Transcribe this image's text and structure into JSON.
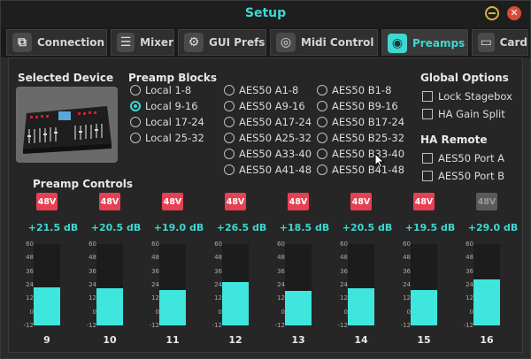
{
  "window": {
    "title": "Setup"
  },
  "tabs": [
    {
      "label": "Connection",
      "icon": "connection-icon",
      "active": false
    },
    {
      "label": "Mixer",
      "icon": "mixer-faders-icon",
      "active": false
    },
    {
      "label": "GUI Prefs",
      "icon": "gears-icon",
      "active": false
    },
    {
      "label": "Midi Control",
      "icon": "midi-port-icon",
      "active": false
    },
    {
      "label": "Preamps",
      "icon": "preamp-icon",
      "active": true
    },
    {
      "label": "Card",
      "icon": "card-icon",
      "active": false
    }
  ],
  "sections": {
    "selected_device": "Selected Device",
    "preamp_blocks": "Preamp Blocks",
    "global_options": "Global Options",
    "ha_remote": "HA Remote",
    "preamp_controls": "Preamp Controls"
  },
  "preamp_blocks": {
    "col1": [
      "Local 1-8",
      "Local 9-16",
      "Local 17-24",
      "Local 25-32"
    ],
    "col2": [
      "AES50 A1-8",
      "AES50 A9-16",
      "AES50 A17-24",
      "AES50 A25-32",
      "AES50 A33-40",
      "AES50 A41-48"
    ],
    "col3": [
      "AES50 B1-8",
      "AES50 B9-16",
      "AES50 B17-24",
      "AES50 B25-32",
      "AES50 B33-40",
      "AES50 B41-48"
    ],
    "selected": "Local 9-16"
  },
  "global_options": [
    {
      "label": "Lock Stagebox",
      "checked": false
    },
    {
      "label": "HA Gain Split",
      "checked": false
    }
  ],
  "ha_remote": [
    {
      "label": "AES50 Port A",
      "checked": false
    },
    {
      "label": "AES50 Port B",
      "checked": false
    }
  ],
  "meter_scale": [
    "60",
    "48",
    "36",
    "24",
    "12",
    "0",
    "-12"
  ],
  "channels": [
    {
      "num": "9",
      "phantom_label": "48V",
      "phantom_on": true,
      "gain": "+21.5 dB",
      "gain_db": 21.5
    },
    {
      "num": "10",
      "phantom_label": "48V",
      "phantom_on": true,
      "gain": "+20.5 dB",
      "gain_db": 20.5
    },
    {
      "num": "11",
      "phantom_label": "48V",
      "phantom_on": true,
      "gain": "+19.0 dB",
      "gain_db": 19.0
    },
    {
      "num": "12",
      "phantom_label": "48V",
      "phantom_on": true,
      "gain": "+26.5 dB",
      "gain_db": 26.5
    },
    {
      "num": "13",
      "phantom_label": "48V",
      "phantom_on": true,
      "gain": "+18.5 dB",
      "gain_db": 18.5
    },
    {
      "num": "14",
      "phantom_label": "48V",
      "phantom_on": true,
      "gain": "+20.5 dB",
      "gain_db": 20.5
    },
    {
      "num": "15",
      "phantom_label": "48V",
      "phantom_on": true,
      "gain": "+19.5 dB",
      "gain_db": 19.5
    },
    {
      "num": "16",
      "phantom_label": "48V",
      "phantom_on": false,
      "gain": "+29.0 dB",
      "gain_db": 29.0
    }
  ],
  "colors": {
    "accent": "#3fd7d0",
    "meter": "#3fe6dd",
    "phantom_on": "#e84053",
    "phantom_off": "#5a5a5a"
  }
}
